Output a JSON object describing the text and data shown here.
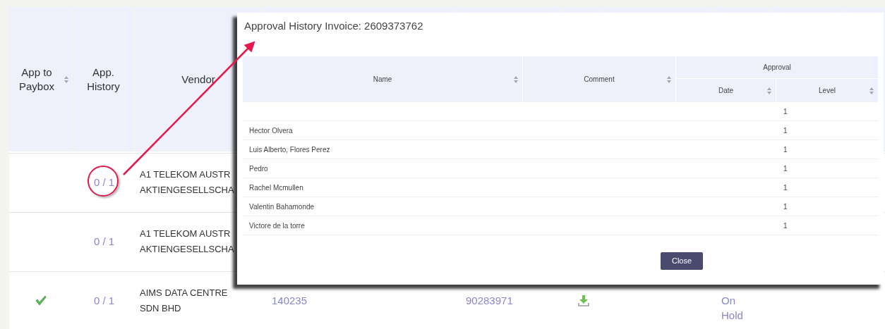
{
  "invoices_table": {
    "columns": [
      {
        "label": "App to Paybox",
        "sortable": true
      },
      {
        "label": "App. History",
        "sortable": false
      },
      {
        "label": "Vendor",
        "sortable": false
      }
    ],
    "rows": [
      {
        "app_to_paybox": false,
        "history": "0 / 1",
        "highlighted": true,
        "vendor": [
          "A1 TELEKOM AUSTR",
          "AKTIENGESELLSCHA"
        ]
      },
      {
        "app_to_paybox": false,
        "history": "0 / 1",
        "highlighted": false,
        "vendor": [
          "A1 TELEKOM AUSTR",
          "AKTIENGESELLSCHA"
        ]
      },
      {
        "app_to_paybox": true,
        "history": "0 / 1",
        "highlighted": false,
        "vendor": [
          "AIMS DATA CENTRE",
          "SDN BHD"
        ],
        "column_4": "140235",
        "column_5": "90283971",
        "column_8": [
          "On",
          "Hold"
        ]
      }
    ]
  },
  "dialog": {
    "title": "Approval History Invoice: 2609373762",
    "columns": {
      "name": "Name",
      "comment": "Comment",
      "group": "Approval",
      "date": "Date",
      "level": "Level"
    },
    "rows": [
      {
        "name": "",
        "level": "1"
      },
      {
        "name": "Hector Olvera",
        "level": "1"
      },
      {
        "name": "Luis Alberto, Flores Perez",
        "level": "1"
      },
      {
        "name": "Pedro",
        "level": "1"
      },
      {
        "name": "Rachel Mcmullen",
        "level": "1"
      },
      {
        "name": "Valentin Bahamonde",
        "level": "1"
      },
      {
        "name": "Victore de la torre",
        "level": "1"
      }
    ],
    "close_button": "Close"
  }
}
